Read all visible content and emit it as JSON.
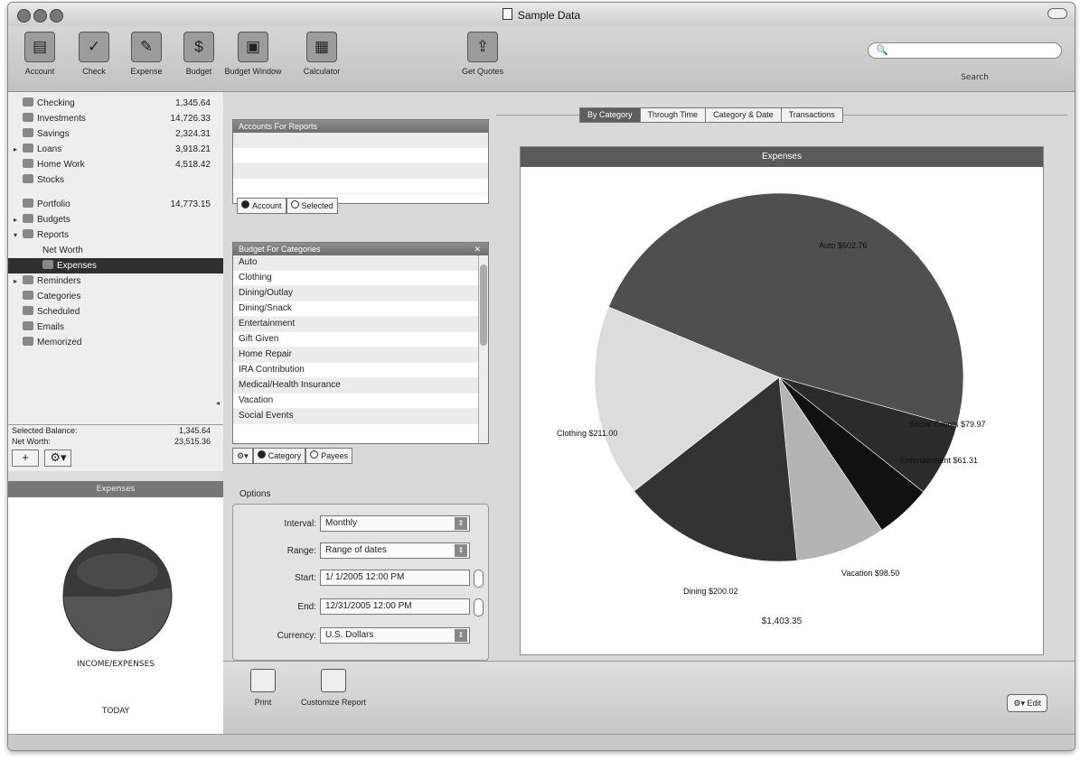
{
  "window": {
    "title": "Sample Data"
  },
  "toolbar": {
    "items": [
      {
        "label": "Account",
        "icon": "account-icon"
      },
      {
        "label": "Check",
        "icon": "check-icon"
      },
      {
        "label": "Expense",
        "icon": "expense-icon"
      },
      {
        "label": "Budget",
        "icon": "budget-icon"
      },
      {
        "label": "Budget Window",
        "icon": "window-icon"
      },
      {
        "label": "Calculator",
        "icon": "calculator-icon"
      },
      {
        "label": "Get Quotes",
        "icon": "quotes-icon"
      }
    ],
    "search_label": "Search",
    "search_placeholder": ""
  },
  "sidebar": {
    "rows": [
      {
        "label": "Checking",
        "amount": "1,345.64",
        "icon": "check-icon",
        "indent": 0
      },
      {
        "label": "Investments",
        "amount": "14,726.33",
        "icon": "investments-icon",
        "indent": 0
      },
      {
        "label": "Savings",
        "amount": "2,324.31",
        "icon": "savings-icon",
        "indent": 0
      },
      {
        "label": "Loans",
        "amount": "3,918.21",
        "icon": "loan-icon",
        "indent": 0,
        "disclosure": "▸"
      },
      {
        "label": "Home Work",
        "amount": "4,518.42",
        "icon": "folder-icon",
        "indent": 0
      },
      {
        "label": "Stocks",
        "amount": "",
        "icon": "stocks-icon",
        "indent": 0
      },
      {
        "label": "Portfolio",
        "amount": "14,773.15",
        "icon": "portfolio-icon",
        "indent": 0,
        "gap": true
      },
      {
        "label": "Budgets",
        "amount": "",
        "icon": "budget-icon",
        "indent": 0,
        "disclosure": "▸"
      },
      {
        "label": "Reports",
        "amount": "",
        "icon": "reports-icon",
        "indent": 0,
        "disclosure": "▾"
      },
      {
        "label": "Net Worth",
        "amount": "",
        "icon": "",
        "indent": 1
      },
      {
        "label": "Expenses",
        "amount": "",
        "icon": "expenses-icon",
        "indent": 1,
        "selected": true
      },
      {
        "label": "Reminders",
        "amount": "",
        "icon": "reminder-icon",
        "indent": 0,
        "disclosure": "▸"
      },
      {
        "label": "Categories",
        "amount": "",
        "icon": "categories-icon",
        "indent": 0
      },
      {
        "label": "Scheduled",
        "amount": "",
        "icon": "scheduled-icon",
        "indent": 0
      },
      {
        "label": "Emails",
        "amount": "",
        "icon": "email-icon",
        "indent": 0
      },
      {
        "label": "Memorized",
        "amount": "",
        "icon": "memorized-icon",
        "indent": 0
      }
    ],
    "footer": [
      {
        "label": "Selected Balance:",
        "value": "1,345.64"
      },
      {
        "label": "Net Worth:",
        "value": "23,515.36"
      }
    ],
    "add_label": "+",
    "action_label": "⚙▾"
  },
  "preview": {
    "header": "Expenses",
    "label1": "INCOME/EXPENSES",
    "label2": "TODAY"
  },
  "accounts_panel": {
    "title": "Accounts For Reports",
    "rows": [
      "",
      "",
      "",
      ""
    ],
    "radio": [
      "Account",
      "Selected"
    ]
  },
  "categories_panel": {
    "title": "Budget For Categories",
    "items": [
      "Auto",
      "Clothing",
      "Dining/Outlay",
      "Dining/Snack",
      "Entertainment",
      "Gift Given",
      "Home Repair",
      "IRA Contribution",
      "Medical/Health Insurance",
      "Vacation",
      "Social Events"
    ],
    "radio": [
      "Category",
      "Payees"
    ]
  },
  "options": {
    "title": "Options",
    "interval_label": "Interval:",
    "interval_value": "Monthly",
    "range_label": "Range:",
    "range_value": "Range of dates",
    "start_label": "Start:",
    "start_value": "1/ 1/2005 12:00 PM",
    "end_label": "End:",
    "end_value": "12/31/2005 12:00 PM",
    "currency_label": "Currency:",
    "currency_value": "U.S. Dollars"
  },
  "tabs": [
    "By Category",
    "Through Time",
    "Category & Date",
    "Transactions"
  ],
  "chart_data": {
    "type": "pie",
    "title": "Expenses",
    "total_label": "$1,403.35",
    "slices": [
      {
        "label": "Auto $602.76",
        "value": 602.76,
        "color": "#4f4f4f"
      },
      {
        "label": "Social Events $79.97",
        "value": 79.97,
        "color": "#2b2b2b"
      },
      {
        "label": "Entertainment $61.31",
        "value": 61.31,
        "color": "#111111"
      },
      {
        "label": "Vacation $98.50",
        "value": 98.5,
        "color": "#b4b4b4"
      },
      {
        "label": "Dining $200.02",
        "value": 200.02,
        "color": "#333333"
      },
      {
        "label": "Clothing $211.00",
        "value": 211.0,
        "color": "#dcdcdc"
      }
    ]
  },
  "bottom": {
    "print_label": "Print",
    "customize_label": "Customize Report",
    "edit_label": "⚙▾ Edit"
  },
  "colors": {
    "window_bg": "#dcdcdc",
    "panel_header": "#6e6e6e",
    "selection": "#2f2f2f"
  }
}
